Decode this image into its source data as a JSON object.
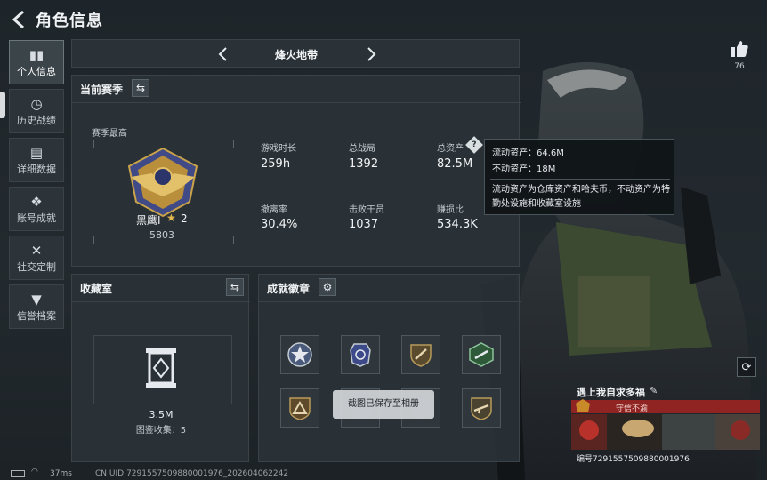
{
  "header": {
    "title": "角色信息",
    "back_icon": "back-arrow-icon"
  },
  "sidebar": {
    "items": [
      {
        "label": "个人信息",
        "icon": "bar-chart-icon",
        "active": true
      },
      {
        "label": "历史战绩",
        "icon": "history-icon",
        "active": false
      },
      {
        "label": "详细数据",
        "icon": "folder-icon",
        "active": false
      },
      {
        "label": "账号成就",
        "icon": "medal-icon",
        "active": false
      },
      {
        "label": "社交定制",
        "icon": "tools-icon",
        "active": false
      },
      {
        "label": "信誉档案",
        "icon": "shield-icon",
        "active": false
      }
    ]
  },
  "mode_bar": {
    "name": "烽火地带"
  },
  "season": {
    "title": "当前赛季",
    "best_label": "赛季最高",
    "rank_name": "黑鹰Ⅰ",
    "rank_level": "2",
    "rank_score": "5803",
    "stats": [
      {
        "label": "游戏时长",
        "value": "259h"
      },
      {
        "label": "总战局",
        "value": "1392"
      },
      {
        "label": "总资产",
        "value": "82.5M"
      },
      {
        "label": "撤离率",
        "value": "30.4%"
      },
      {
        "label": "击败干员",
        "value": "1037"
      },
      {
        "label": "赚损比",
        "value": "534.3K"
      }
    ]
  },
  "tooltip": {
    "line1": "流动资产：64.6M",
    "line2": "不动资产：18M",
    "desc": "流动资产为仓库资产和哈夫币，不动资产为特勤处设施和收藏室设施"
  },
  "collection": {
    "title": "收藏室",
    "value": "3.5M",
    "count_text": "图鉴收集：5"
  },
  "badges": {
    "title": "成就徽章",
    "items": [
      {
        "icon": "star-badge-icon"
      },
      {
        "icon": "police-badge-icon"
      },
      {
        "icon": "gun-badge-icon"
      },
      {
        "icon": "green-gun-badge-icon"
      },
      {
        "icon": "triangle-badge-icon"
      },
      {
        "icon": "hidden-badge-icon"
      },
      {
        "icon": "hidden-badge-icon"
      },
      {
        "icon": "rifle-badge-icon"
      }
    ]
  },
  "toast": {
    "text": "截图已保存至相册"
  },
  "like": {
    "count": "76"
  },
  "profile_card": {
    "name": "遇上我自求多福",
    "tag": "守信不渝",
    "uid": "编号7291557509880001976"
  },
  "status_bar": {
    "ping": "37ms",
    "uid_text": "CN UID:7291557509880001976_202604062242"
  },
  "colors": {
    "accent_gold": "#e3b54f",
    "banner_red": "#8f2422",
    "panel_bg": "#2a3237"
  }
}
